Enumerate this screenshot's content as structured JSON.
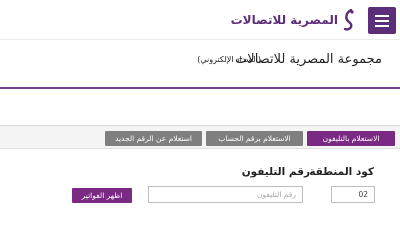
{
  "header": {
    "logo_text": "المصرية للاتصالات",
    "menu_icon": "hamburger-menu-icon",
    "menu_color": "#5c2d78"
  },
  "page": {
    "title": "مجموعة المصرية للاتصالات",
    "subtitle": "(السداد الإلكتروني)"
  },
  "tabs": [
    {
      "label": "الاستعلام بالتليفون",
      "active": true
    },
    {
      "label": "الاستعلام برقم الحساب",
      "active": false
    },
    {
      "label": "استعلام عن الرقم الجديد",
      "active": false
    }
  ],
  "form": {
    "area_code_label": "كود المنطقة",
    "phone_label": "رقم التليفون",
    "area_code_value": "02",
    "phone_placeholder": "رقم التليفون",
    "submit_label": "اظهر الفواتير"
  },
  "colors": {
    "brand": "#5c2d78",
    "active_tab": "#7b2a83",
    "inactive_tab": "#7f7f7f"
  }
}
